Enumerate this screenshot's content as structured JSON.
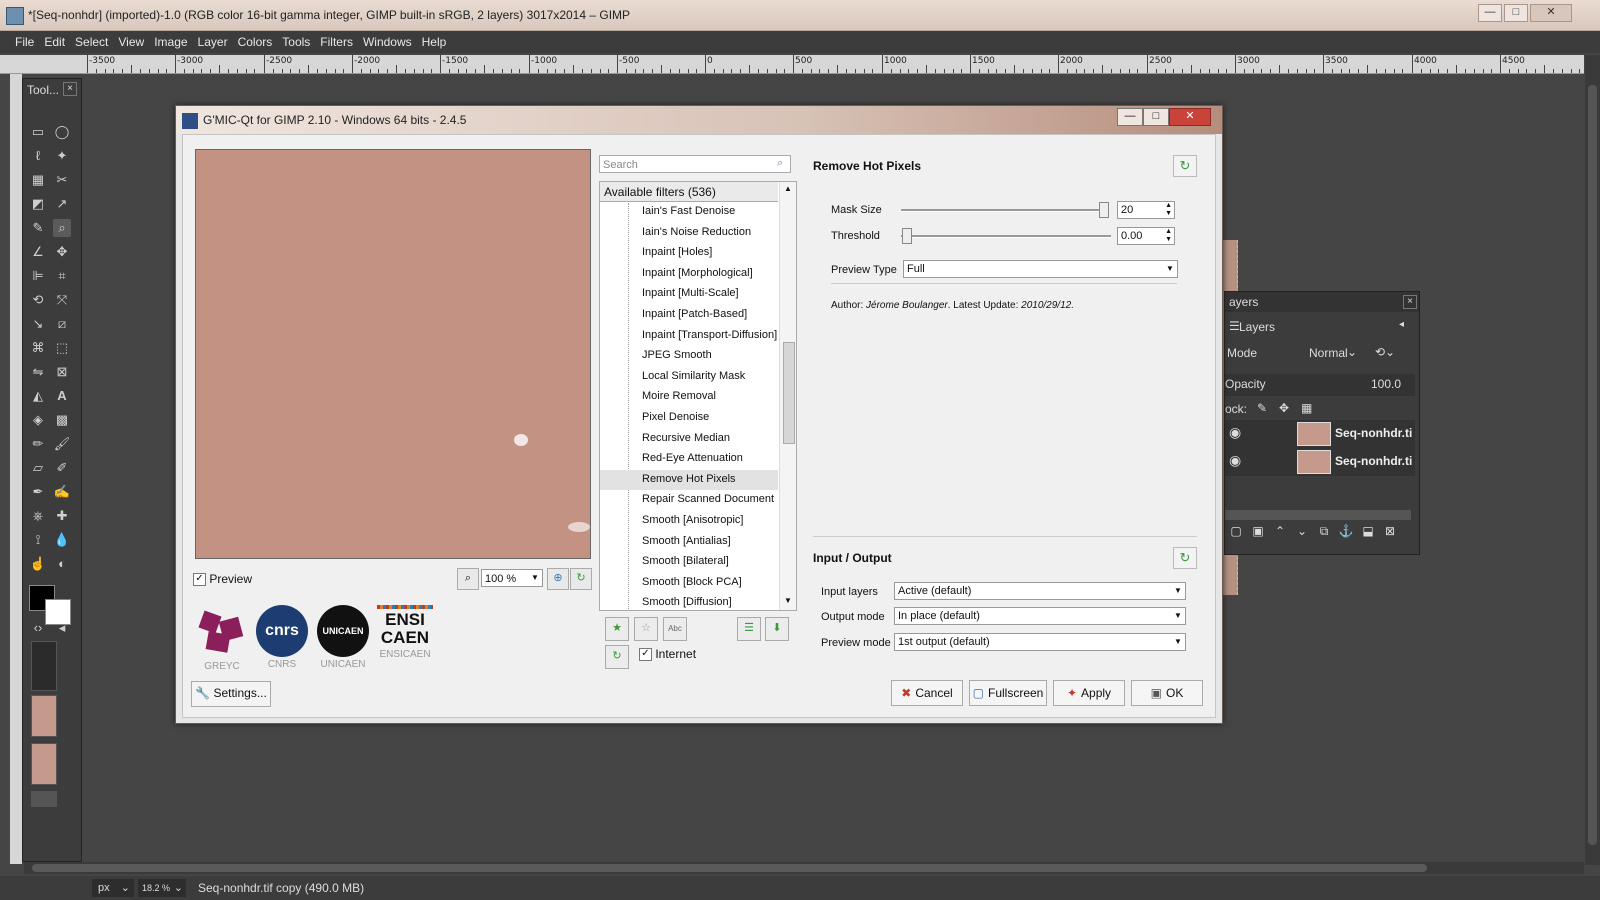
{
  "window": {
    "title": "*[Seq-nonhdr] (imported)-1.0 (RGB color 16-bit gamma integer, GIMP built-in sRGB, 2 layers) 3017x2014 – GIMP"
  },
  "menu": [
    "File",
    "Edit",
    "Select",
    "View",
    "Image",
    "Layer",
    "Colors",
    "Tools",
    "Filters",
    "Windows",
    "Help"
  ],
  "ruler": {
    "h_labels": [
      "-3500",
      "-3000",
      "-2500",
      "-2000",
      "-1500",
      "-1000",
      "-500",
      "0",
      "500",
      "1000",
      "1500",
      "2000",
      "2500",
      "3000",
      "3500",
      "4000",
      "4500"
    ]
  },
  "toolbox": {
    "title": "Tool...",
    "close": "×"
  },
  "status": {
    "unit": "px",
    "zoom": "18.2 %",
    "message": "Seq-nonhdr.tif copy (490.0 MB)"
  },
  "layers_dock": {
    "title": "ayers",
    "tab": "Layers",
    "mode_label": "Mode",
    "mode_value": "Normal",
    "opacity_label": "Opacity",
    "opacity_value": "100.0",
    "lock_label": "ock:",
    "layers": [
      {
        "name": "Seq-nonhdr.ti"
      },
      {
        "name": "Seq-nonhdr.ti"
      }
    ]
  },
  "gmic": {
    "title": "G'MIC-Qt for GIMP 2.10 - Windows 64 bits - 2.4.5",
    "preview_label": "Preview",
    "zoom_value": "100 %",
    "logos": [
      {
        "text": "GREYC",
        "color": "#8a1f5c"
      },
      {
        "text": "CNRS",
        "color": "#1d3d72"
      },
      {
        "text": "UNICAEN",
        "color": "#111111"
      },
      {
        "text": "ENSICAEN",
        "color": "#111111"
      }
    ],
    "logo_marks": {
      "cnrs": "cnrs",
      "unicaen": "UNICAEN",
      "ensicaen": "ENSI CAEN"
    },
    "settings_label": "Settings...",
    "search_placeholder": "Search",
    "filters_header": "Available filters (536)",
    "filters": [
      "Iain's Fast Denoise",
      "Iain's Noise Reduction",
      "Inpaint [Holes]",
      "Inpaint [Morphological]",
      "Inpaint [Multi-Scale]",
      "Inpaint [Patch-Based]",
      "Inpaint [Transport-Diffusion]",
      "JPEG Smooth",
      "Local Similarity Mask",
      "Moire Removal",
      "Pixel Denoise",
      "Recursive Median",
      "Red-Eye Attenuation",
      "Remove Hot Pixels",
      "Repair Scanned Document",
      "Smooth [Anisotropic]",
      "Smooth [Antialias]",
      "Smooth [Bilateral]",
      "Smooth [Block PCA]",
      "Smooth [Diffusion]"
    ],
    "selected_filter": "Remove Hot Pixels",
    "internet_label": "Internet",
    "filter_name": "Remove Hot Pixels",
    "params": {
      "mask_size_label": "Mask Size",
      "mask_size_value": "20",
      "threshold_label": "Threshold",
      "threshold_value": "0.00",
      "preview_type_label": "Preview Type",
      "preview_type_value": "Full",
      "author_prefix": "Author: ",
      "author_name": "Jérome Boulanger",
      "author_mid": ". Latest Update: ",
      "author_date": "2010/29/12."
    },
    "io": {
      "header": "Input / Output",
      "input_layers_label": "Input layers",
      "input_layers_value": "Active (default)",
      "output_mode_label": "Output mode",
      "output_mode_value": "In place (default)",
      "preview_mode_label": "Preview mode",
      "preview_mode_value": "1st output (default)"
    },
    "buttons": {
      "cancel": "Cancel",
      "fullscreen": "Fullscreen",
      "apply": "Apply",
      "ok": "OK"
    }
  }
}
